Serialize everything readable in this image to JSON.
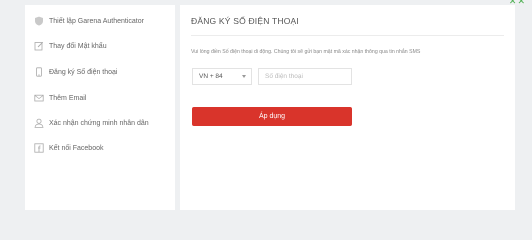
{
  "sidebar": {
    "items": [
      {
        "label": "Thiết lập Garena Authenticator",
        "icon": "shield-icon"
      },
      {
        "label": "Thay đổi Mật khẩu",
        "icon": "edit-icon"
      },
      {
        "label": "Đăng ký Số điện thoại",
        "icon": "phone-icon"
      },
      {
        "label": "Thêm Email",
        "icon": "email-icon"
      },
      {
        "label": "Xác nhận chứng minh nhân dân",
        "icon": "user-icon"
      },
      {
        "label": "Kết nối Facebook",
        "icon": "facebook-icon"
      }
    ]
  },
  "main": {
    "title": "ĐĂNG KÝ SỐ ĐIỆN THOẠI",
    "instruction": "Vui lòng điền Số điện thoại di động. Chúng tôi sẽ gửi bạn mật mã xác nhận thông qua tin nhắn SMS",
    "country_code": "VN + 84",
    "phone_placeholder": "Số điện thoại",
    "phone_value": "",
    "apply_label": "Áp dụng"
  },
  "colors": {
    "background": "#eef0f2",
    "panel": "#ffffff",
    "accent_red": "#d9342b",
    "text": "#555555",
    "muted_text": "#888888"
  }
}
